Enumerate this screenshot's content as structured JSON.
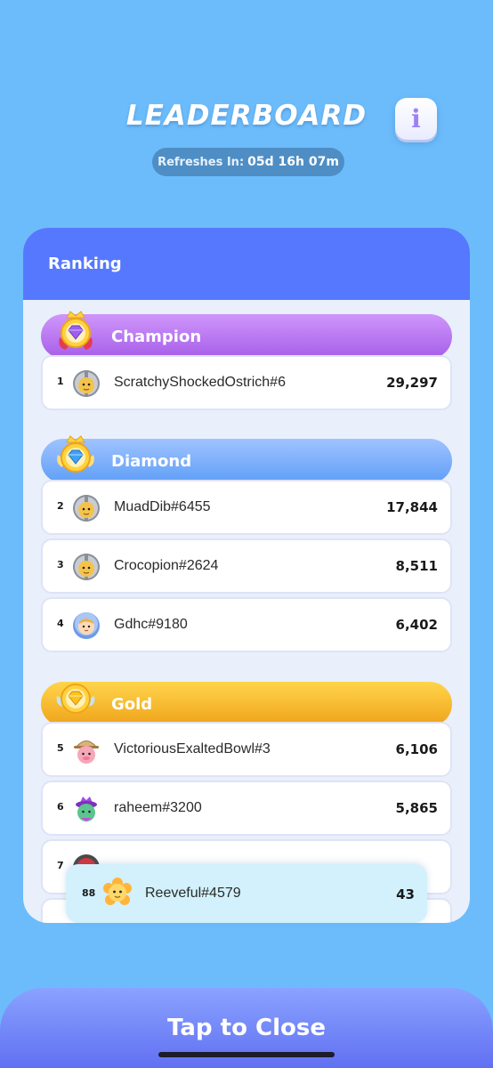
{
  "header": {
    "title": "LEADERBOARD",
    "info_label": "i",
    "refresh_label": "Refreshes In:",
    "refresh_value": "05d 16h 07m"
  },
  "panel": {
    "title": "Ranking",
    "tiers": [
      {
        "name": "Champion",
        "color": "#b878f2",
        "icon": "champion-crown-gem-icon"
      },
      {
        "name": "Diamond",
        "color": "#7fb2fa",
        "icon": "diamond-crown-gem-icon"
      },
      {
        "name": "Gold",
        "color": "#f7bc33",
        "icon": "gold-winged-gem-icon"
      }
    ],
    "rows": [
      {
        "rank": "1",
        "name": "ScratchyShockedOstrich#6",
        "score": "29,297",
        "avatar": "knight-helmet-avatar"
      },
      {
        "rank": "2",
        "name": "MuadDib#6455",
        "score": "17,844",
        "avatar": "knight-helmet-avatar"
      },
      {
        "rank": "3",
        "name": "Crocopion#2624",
        "score": "8,511",
        "avatar": "knight-helmet-avatar"
      },
      {
        "rank": "4",
        "name": "Gdhc#9180",
        "score": "6,402",
        "avatar": "hooded-kid-avatar"
      },
      {
        "rank": "5",
        "name": "VictoriousExaltedBowl#3",
        "score": "6,106",
        "avatar": "pink-explorer-avatar"
      },
      {
        "rank": "6",
        "name": "raheem#3200",
        "score": "5,865",
        "avatar": "green-king-avatar"
      },
      {
        "rank": "7",
        "name": "",
        "score": "",
        "avatar": "red-helmet-avatar"
      }
    ],
    "current_user": {
      "rank": "88",
      "name": "Reeveful#4579",
      "score": "43",
      "avatar": "flower-avatar"
    }
  },
  "footer": {
    "close_label": "Tap to Close"
  }
}
